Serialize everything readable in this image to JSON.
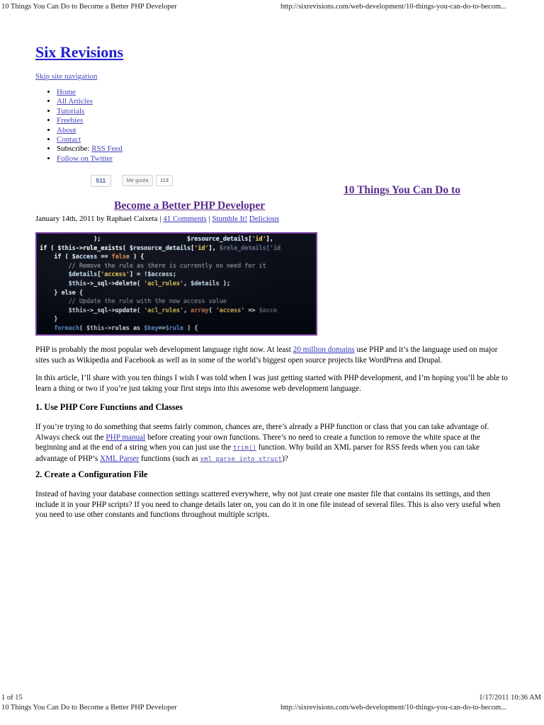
{
  "print_chrome": {
    "header_left": "10 Things You Can Do to Become a Better PHP Developer",
    "header_right": "http://sixrevisions.com/web-development/10-things-you-can-do-to-becom...",
    "footer_page": "1 of 15",
    "footer_timestamp": "1/17/2011 10:36 AM",
    "footer_left": "10 Things You Can Do to Become a Better PHP Developer",
    "footer_right": "http://sixrevisions.com/web-development/10-things-you-can-do-to-becom..."
  },
  "site": {
    "title": "Six Revisions",
    "skip_nav": "Skip site navigation",
    "nav": [
      {
        "label": "Home",
        "link": true
      },
      {
        "label": "All Articles",
        "link": true
      },
      {
        "label": "Tutorials",
        "link": true
      },
      {
        "label": "Freebies",
        "link": true
      },
      {
        "label": "About",
        "link": true
      },
      {
        "label": "Contact",
        "link": true
      },
      {
        "prefix": "Subscribe: ",
        "label": "RSS Feed",
        "link": true
      },
      {
        "label": "Follow on Twitter",
        "link": true
      }
    ]
  },
  "social": {
    "share_count": "511",
    "facebook_like_label": "Me gusta",
    "facebook_like_count": "113"
  },
  "article": {
    "title_line1": "10 Things You Can Do to",
    "title_line2": "Become a Better PHP Developer",
    "byline": {
      "date": "January 14th, 2011",
      "by": " by ",
      "author": "Raphael Caixeta",
      "sep1": " | ",
      "comments": "41 Comments",
      "sep2": " | ",
      "stumble": "Stumble It!",
      "space": " ",
      "delicious": "Delicious"
    },
    "hero_image": {
      "alt": "php-code-screenshot",
      "code_lines": [
        "               );                        $resource_details['id'],",
        "if ( $this->rule_exists( $resource_details['id'], $role_details['id",
        "    if ( $access == false ) {",
        "        // Remove the rule as there is currently no need for it",
        "        $details['access'] = !$access;",
        "        $this->_sql->delete( 'acl_rules', $details );",
        "    } else {",
        "        // Update the rule with the new access value",
        "        $this->_sql->update( 'acl_rules', array( 'access' => $acce",
        "    }",
        "    foreach( $this->rules as $key=>$rule ) {"
      ]
    },
    "paragraphs": {
      "intro1_a": "PHP is probably the most popular web development language right now. At least ",
      "intro1_link": "20 million domains",
      "intro1_b": " use PHP and it’s the language used on major sites such as Wikipedia and Facebook as well as in some of the world’s biggest open source projects like WordPress and Drupal.",
      "intro2": "In this article, I’ll share with you ten things I wish I was told when I was just getting started with PHP development, and I’m hoping you’ll be able to learn a thing or two if you’re just taking your first steps into this awesome web development language."
    },
    "sections": [
      {
        "heading": "1. Use PHP Core Functions and Classes",
        "body_a": "If you’re trying to do something that seems fairly common, chances are, there’s already a PHP function or class that you can take advantage of. Always check out the ",
        "link1": "PHP manual",
        "body_b": " before creating your own functions. There’s no need to create a function to remove the white space at the beginning and at the end of a string when you can just use the ",
        "code1": "trim()",
        "body_c": " function. Why build an XML parser for RSS feeds when you can take advantage of PHP’s ",
        "link2": "XML Parser",
        "body_d": " functions (such as ",
        "code2": "xml_parse_into_struct",
        "body_e": ")?"
      },
      {
        "heading": "2. Create a Configuration File",
        "body": "Instead of having your database connection settings scattered everywhere, why not just create one master file that contains its settings, and then include it in your PHP scripts? If you need to change details later on, you can do it in one file instead of several files. This is also very useful when you need to use other constants and functions throughout multiple scripts."
      }
    ]
  },
  "colors": {
    "site_title_link": "#2222cc",
    "nav_link": "#4444bb",
    "article_title_link": "#5b2d8e",
    "body_link": "#3333bb",
    "image_border": "#7a3fa0",
    "code_background": "#060a14"
  }
}
